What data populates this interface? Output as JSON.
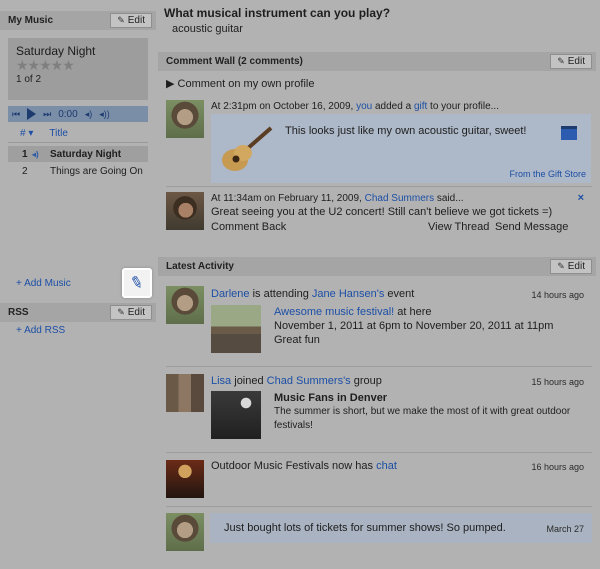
{
  "sidebar": {
    "my_music_title": "My Music",
    "edit_label": "Edit",
    "now_playing": "Saturday Night",
    "rating_stars": "★★★★★",
    "song_position": "1 of 2",
    "time": "0:00",
    "col_num": "#",
    "col_title": "Title",
    "tracks": [
      {
        "num": "1",
        "title": "Saturday Night"
      },
      {
        "num": "2",
        "title": "Things are Going On"
      }
    ],
    "add_music": "+ Add Music",
    "rss_title": "RSS",
    "add_rss": "+ Add RSS"
  },
  "main": {
    "question": "What musical instrument can you play?",
    "answer": "acoustic guitar",
    "wall_title": "Comment Wall (2 comments)",
    "comment_on_profile": "Comment on my own profile",
    "post1": {
      "prefix": "At 2:31pm on October 16, 2009, ",
      "you": "you",
      "added": " added a ",
      "gift": "gift",
      "suffix": " to your profile...",
      "gift_text": "This looks just like my own acoustic guitar, sweet!",
      "gift_footer": "From the Gift Store"
    },
    "post2": {
      "prefix": "At 11:34am on February 11, 2009, ",
      "author": "Chad Summers",
      "said": " said...",
      "text": "Great seeing you at the U2 concert! Still can't believe we got tickets =)",
      "comment_back": "Comment Back",
      "view_thread": "View Thread",
      "send_message": "Send Message",
      "close": "×"
    },
    "latest_title": "Latest Activity",
    "activities": [
      {
        "actor": "Darlene",
        "verb": " is attending ",
        "target": "Jane Hansen's",
        "tail": " event",
        "time": "14 hours ago",
        "event_name": "Awesome music festival!",
        "event_loc": " at here",
        "event_dates": "November 1, 2011 at 6pm to November 20, 2011 at 11pm",
        "event_desc": "Great fun"
      },
      {
        "actor": "Lisa",
        "verb": " joined ",
        "target": "Chad Summers's",
        "tail": " group",
        "time": "15 hours ago",
        "group_name": "Music Fans in Denver",
        "group_desc_1": "The summer is short, but we make the most of it with great outdoor",
        "group_desc_2": "festivals!"
      },
      {
        "text": "Outdoor Music Festivals now has ",
        "link": "chat",
        "time": "16 hours ago"
      },
      {
        "text": "Just bought lots of tickets for summer shows! So pumped.",
        "time": "March 27"
      }
    ]
  }
}
